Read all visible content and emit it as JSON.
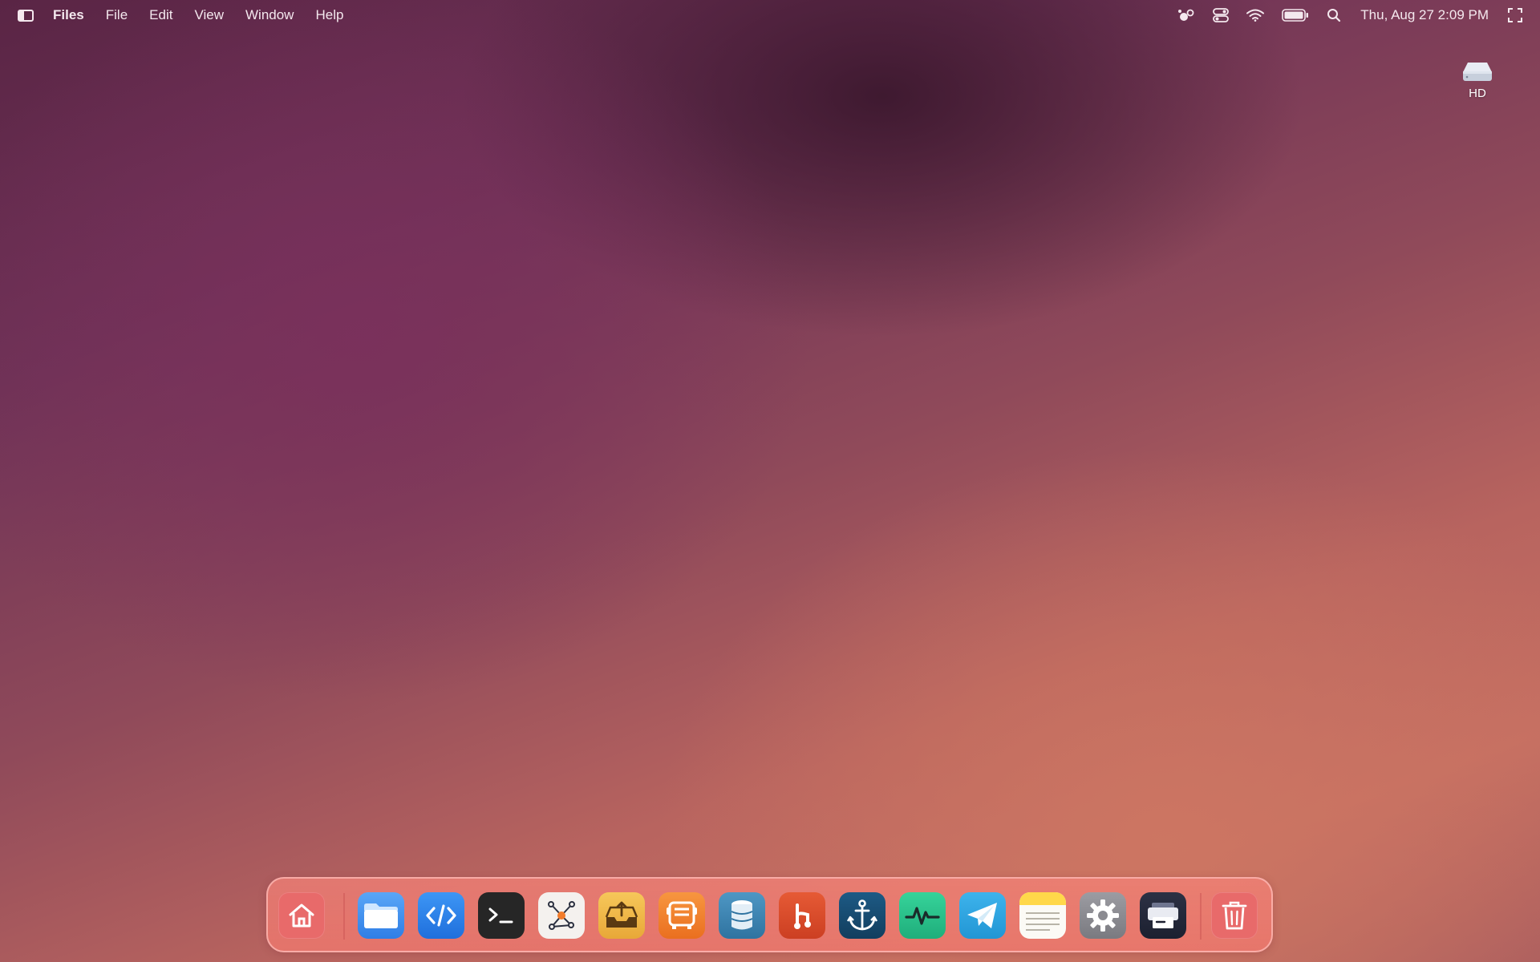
{
  "menubar": {
    "app_name": "Files",
    "menus": [
      "File",
      "Edit",
      "View",
      "Window",
      "Help"
    ],
    "clock": "Thu, Aug 27  2:09 PM",
    "status_icons": [
      "people-icon",
      "control-center-icon",
      "wifi-icon",
      "battery-icon",
      "search-icon",
      "fullscreen-icon"
    ]
  },
  "desktop": {
    "hd_label": "HD"
  },
  "dock": {
    "items": [
      {
        "name": "home",
        "color": "#e86a6a"
      },
      {
        "name": "files",
        "color": "#3d8ef0"
      },
      {
        "name": "code-editor",
        "color": "#2f7ee6"
      },
      {
        "name": "terminal",
        "color": "#262626"
      },
      {
        "name": "graph-tool",
        "color": "#f4f1ee"
      },
      {
        "name": "inbox-upload",
        "color": "#f1b94a"
      },
      {
        "name": "bus-transit",
        "color": "#f0832a"
      },
      {
        "name": "database",
        "color": "#3f86b4"
      },
      {
        "name": "git-branch",
        "color": "#dc4b2c"
      },
      {
        "name": "anchor",
        "color": "#174a6e"
      },
      {
        "name": "activity-monitor",
        "color": "#2cc38e"
      },
      {
        "name": "telegram",
        "color": "#2ea5e2"
      },
      {
        "name": "notes",
        "color": "#ffd84a"
      },
      {
        "name": "settings",
        "color": "#8e8e93"
      },
      {
        "name": "printer",
        "color": "#232838"
      },
      {
        "name": "trash",
        "color": "#e86a6a"
      }
    ]
  }
}
